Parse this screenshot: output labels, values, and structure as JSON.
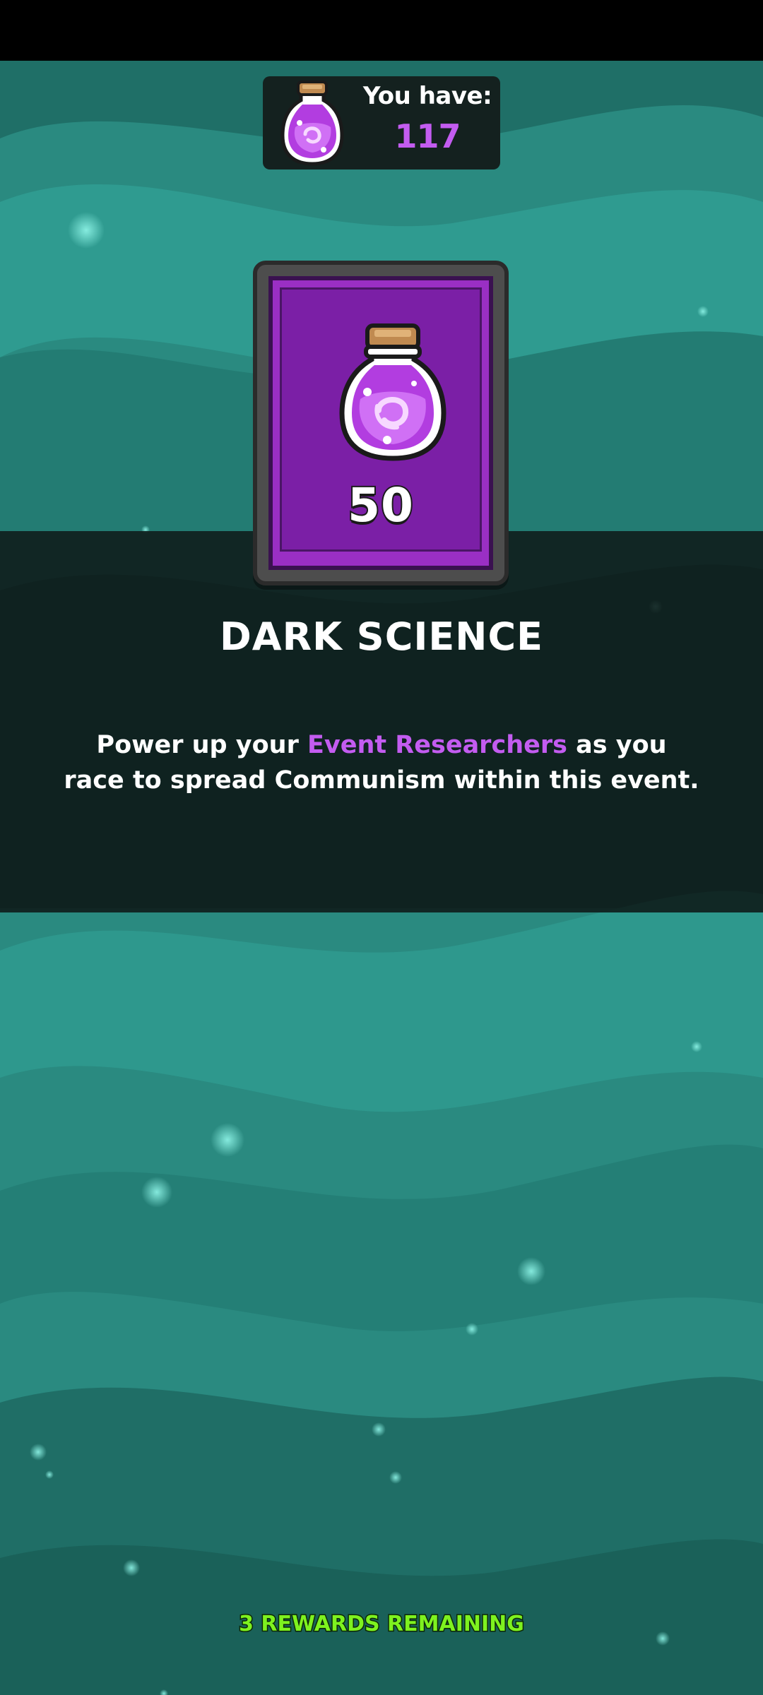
{
  "currency": {
    "label": "You have:",
    "value": "117",
    "icon": "dark-science-flask-icon"
  },
  "reward_card": {
    "amount": "50",
    "icon": "dark-science-flask-icon",
    "frame_color": "#9a2fc4"
  },
  "title": "DARK SCIENCE",
  "description": {
    "before": "Power up your ",
    "highlight": "Event Researchers",
    "after": " as you race to spread Communism within this event."
  },
  "rewards_remaining": "3 REWARDS REMAINING",
  "colors": {
    "background_teal": "#2a8f85",
    "accent_purple": "#c35cf0",
    "rewards_green": "#7ef21f"
  }
}
